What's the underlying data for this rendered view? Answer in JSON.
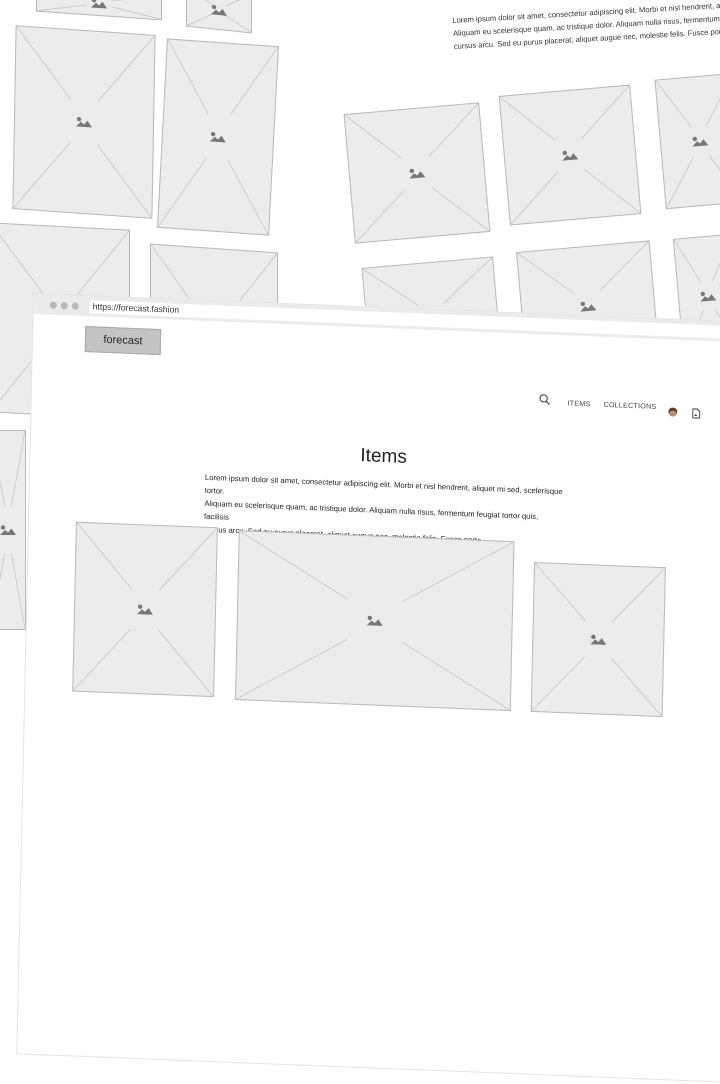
{
  "background_page": {
    "paragraph": "Lorem ipsum dolor sit amet, consectetur adipiscing elit. Morbi et nisl hendrerit, ali\nAliquam eu scelerisque quam, ac tristique dolor. Aliquam nulla risus, fermentum fe\ncursus arcu. Sed eu purus placerat, aliquet augue nec, molestie felis. Fusce porta"
  },
  "browser": {
    "url": "https://forecast.fashion",
    "logo_label": "forecast",
    "nav": {
      "search_icon": "search-icon",
      "items_label": "ITEMS",
      "collections_label": "COLLECTIONS",
      "avatar": "avatar",
      "file_icon": "file-icon"
    },
    "page": {
      "title": "Items",
      "description": "Lorem ipsum dolor sit amet, consectetur adipiscing elit. Morbi et nisl hendrerit, aliquet mi sed, scelerisque tortor.\nAliquam eu scelerisque quam, ac tristique dolor. Aliquam nulla risus, fermentum feugiat tortor quis, facilisis\ncursus arcu. Sed eu purus placerat, aliquet augue nec, molestie felis. Fusce porta."
    }
  },
  "icons": [
    "image-placeholder-icon",
    "search-icon",
    "file-icon"
  ],
  "colors": {
    "placeholder_fill": "#ececec",
    "placeholder_border": "#b9b9b9",
    "chrome_bar": "#ebebeb",
    "logo_button": "#c4c4c4"
  }
}
